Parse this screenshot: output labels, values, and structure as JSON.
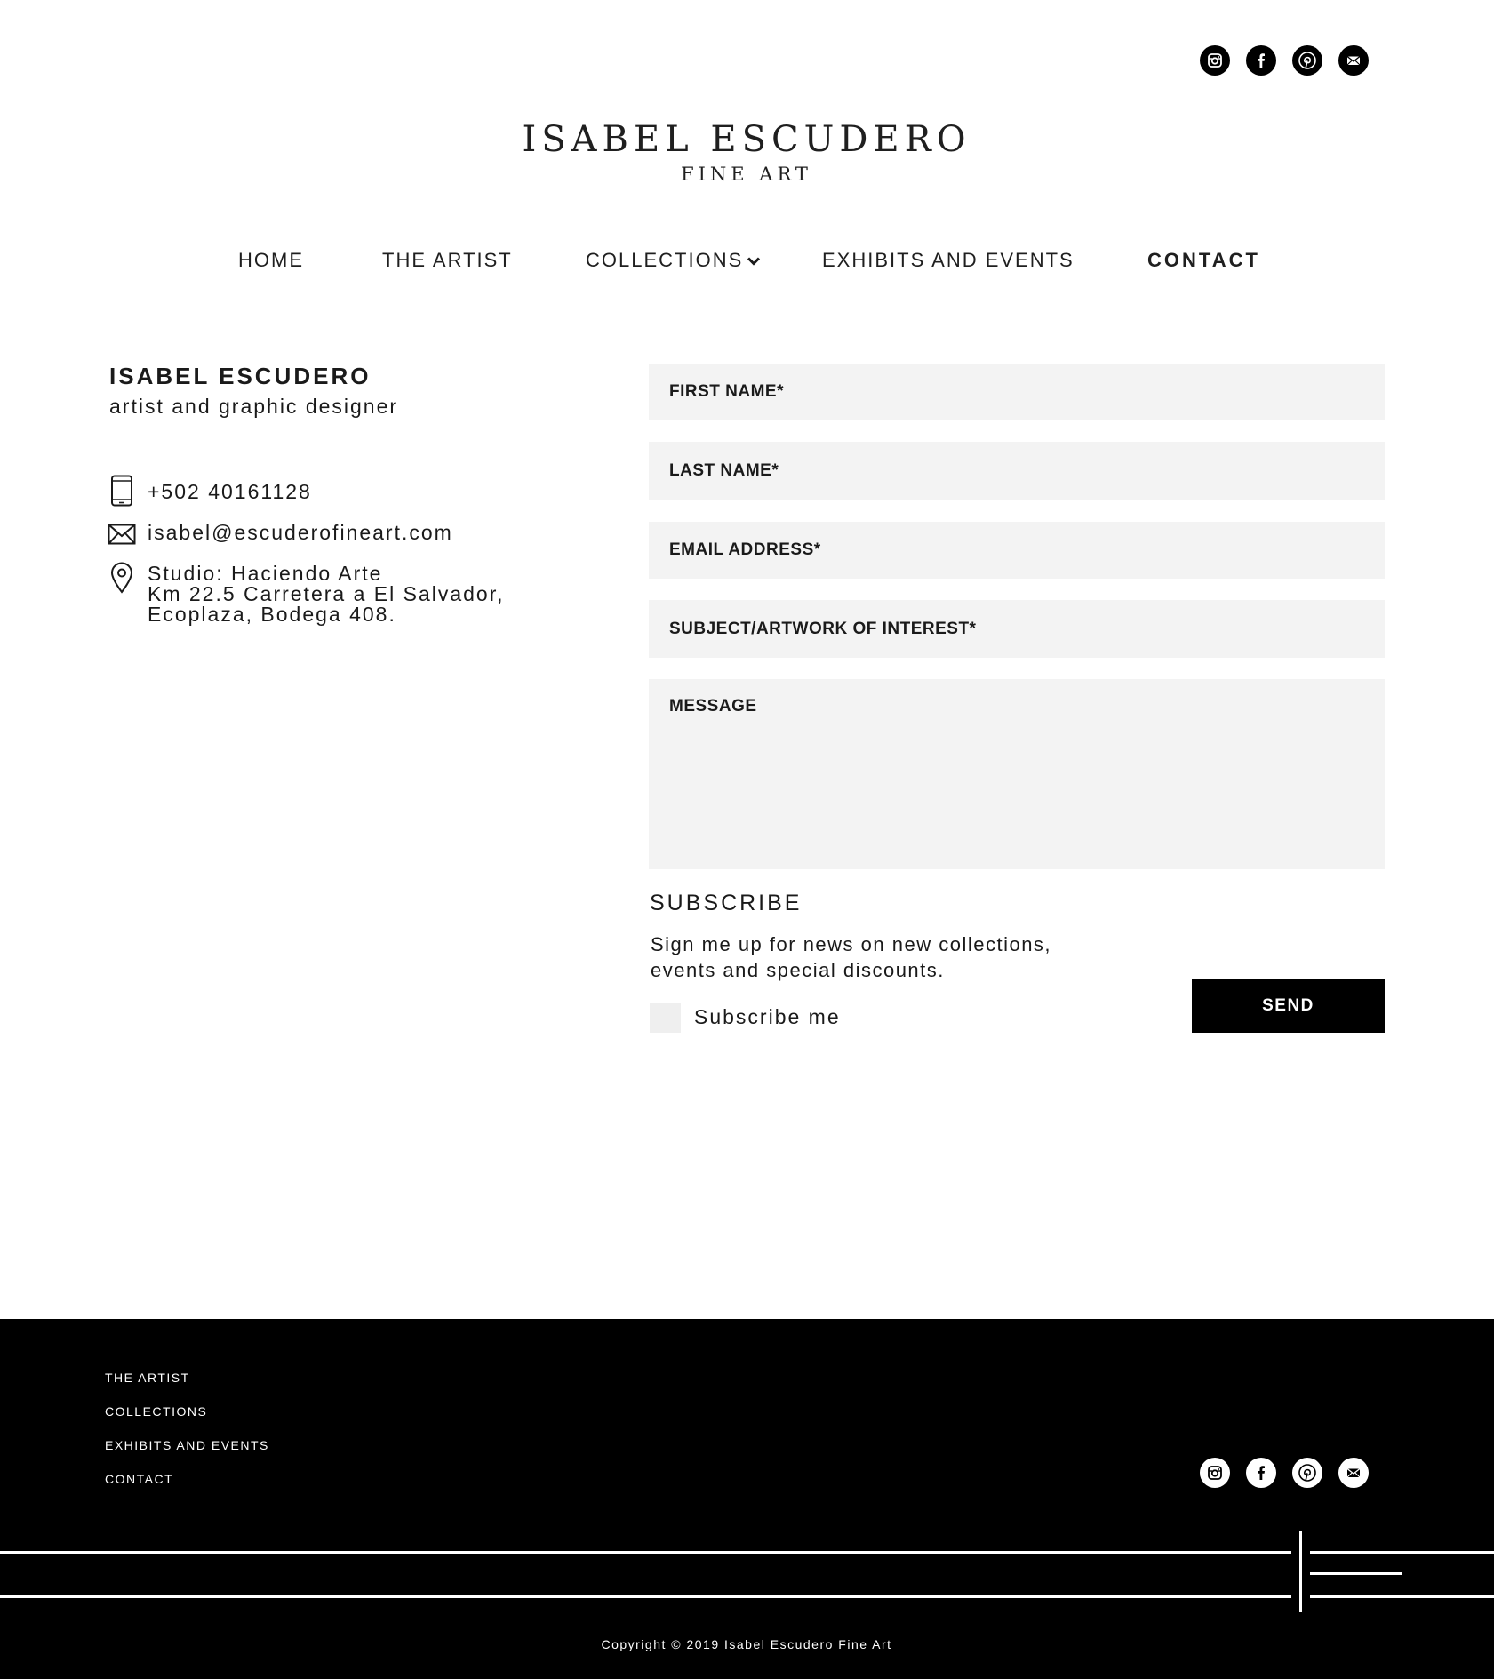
{
  "header": {
    "social_icons": [
      "instagram-icon",
      "facebook-icon",
      "pinterest-icon",
      "mail-icon"
    ]
  },
  "logo": {
    "title": "ISABEL ESCUDERO",
    "subtitle": "FINE ART"
  },
  "nav": {
    "items": [
      {
        "label": "HOME"
      },
      {
        "label": "THE ARTIST"
      },
      {
        "label": "COLLECTIONS"
      },
      {
        "label": "EXHIBITS AND EVENTS"
      },
      {
        "label": "CONTACT"
      }
    ],
    "active": "CONTACT"
  },
  "contact_info": {
    "name": "ISABEL ESCUDERO",
    "role": "artist and graphic designer",
    "phone": "+502 40161128",
    "email": "isabel@escuderofineart.com",
    "address": {
      "line1": "Studio: Haciendo Arte",
      "line2": "Km 22.5 Carretera a El Salvador,",
      "line3": "Ecoplaza, Bodega 408."
    }
  },
  "form": {
    "first_name": "FIRST NAME*",
    "last_name": "LAST NAME*",
    "email": "EMAIL ADDRESS*",
    "subject": "SUBJECT/ARTWORK OF INTEREST*",
    "message": "MESSAGE",
    "subscribe_title": "SUBSCRIBE",
    "subscribe_text_1": "Sign me up for news on new collections,",
    "subscribe_text_2": "events and special discounts.",
    "subscribe_checkbox_label": "Subscribe me",
    "subscribe_checked": false,
    "send_label": "SEND"
  },
  "footer": {
    "links": [
      {
        "label": "THE ARTIST"
      },
      {
        "label": "COLLECTIONS"
      },
      {
        "label": "EXHIBITS AND EVENTS"
      },
      {
        "label": "CONTACT"
      }
    ],
    "copyright": "Copyright © 2019 Isabel Escudero Fine Art"
  },
  "colors": {
    "background": "#ffffff",
    "text": "#1a1a1a",
    "field_background": "#f3f3f3",
    "footer_background": "#000000",
    "button_background": "#000000"
  }
}
